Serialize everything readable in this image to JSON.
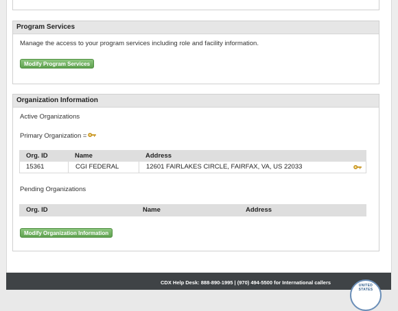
{
  "program_services": {
    "header": "Program Services",
    "description": "Manage the access to your program services including role and facility information.",
    "modify_button": "Modify Program Services"
  },
  "organization_info": {
    "header": "Organization Information",
    "active_label": "Active Organizations",
    "primary_label": "Primary Organization =",
    "active_table": {
      "headers": [
        "Org. ID",
        "Name",
        "Address"
      ],
      "rows": [
        {
          "org_id": "15361",
          "name": "CGI FEDERAL",
          "address": "12601 FAIRLAKES CIRCLE, FAIRFAX, VA, US 22033"
        }
      ]
    },
    "pending_label": "Pending Organizations",
    "pending_table": {
      "headers": [
        "Org. ID",
        "Name",
        "Address"
      ]
    },
    "modify_button": "Modify Organization Information"
  },
  "footer": {
    "help_text": "CDX Help Desk: 888-890-1995 | (970) 494-5500 for International callers",
    "seal_text": "UNITED STATES"
  },
  "icons": {
    "key": "key-icon"
  },
  "colors": {
    "button_green": "#5fa14f",
    "footer_bg": "#3f4346",
    "panel_header_bg": "#e6e6e6"
  }
}
